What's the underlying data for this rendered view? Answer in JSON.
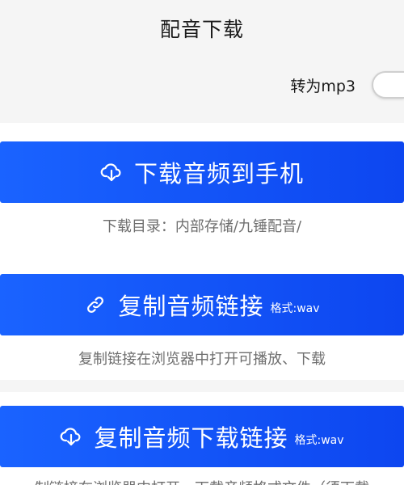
{
  "header": {
    "title": "配音下载"
  },
  "mp3_toggle": {
    "label": "转为mp3",
    "checked": false
  },
  "actions": [
    {
      "label": "下载音频到手机",
      "icon": "cloud-download-icon",
      "format": "",
      "caption": "下载目录：内部存储/九锤配音/"
    },
    {
      "label": "复制音频链接",
      "icon": "link-icon",
      "format": "格式:wav",
      "caption": "复制链接在浏览器中打开可播放、下载"
    },
    {
      "label": "复制音频下载链接",
      "icon": "cloud-download-icon",
      "format": "格式:wav",
      "caption": "制链接在浏览器中打开，下载音频格式文件（须下载"
    }
  ],
  "colors": {
    "button": "#1558fb",
    "caption": "#6e6e6e",
    "background": "#f5f5f5"
  }
}
